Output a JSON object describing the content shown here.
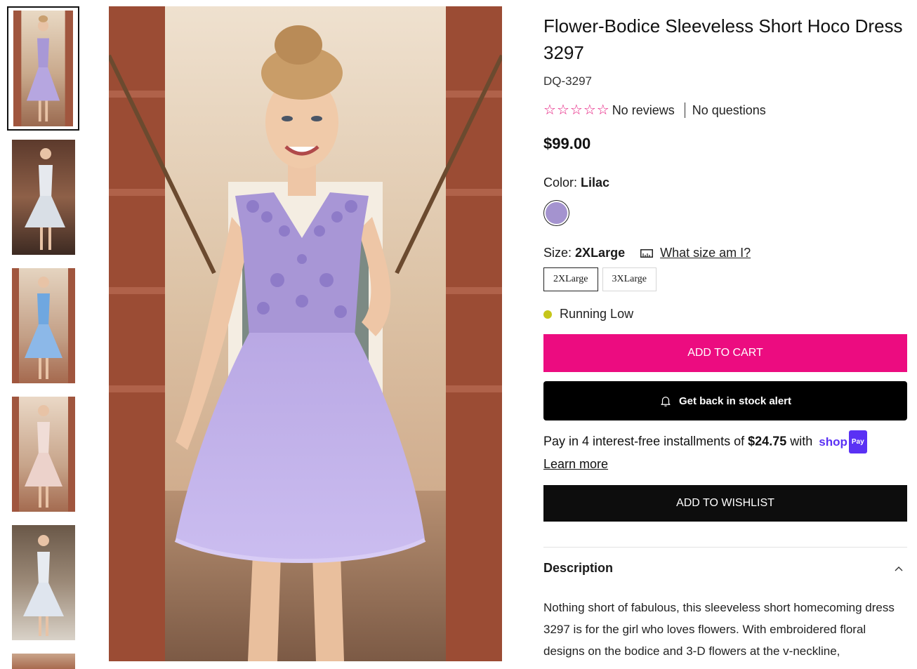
{
  "product": {
    "title": "Flower-Bodice Sleeveless Short Hoco Dress 3297",
    "sku": "DQ-3297",
    "reviews": "No reviews",
    "questions": "No questions",
    "rating": 0,
    "price": "$99.00"
  },
  "color": {
    "label": "Color:",
    "value": "Lilac",
    "swatch_hex": "#a493cf"
  },
  "size": {
    "label": "Size:",
    "value": "2XLarge",
    "guide_link": "What size am I?",
    "options": [
      "2XLarge",
      "3XLarge"
    ]
  },
  "stock": {
    "text": "Running Low",
    "dot_color": "#c6c61a"
  },
  "buttons": {
    "add_to_cart": "ADD TO CART",
    "stock_alert": "Get back in stock alert",
    "wishlist": "ADD TO WISHLIST"
  },
  "shoppay": {
    "prefix": "Pay in 4 interest-free installments of",
    "amount": "$24.75",
    "suffix": "with",
    "logo_text": "shop",
    "logo_badge": "Pay",
    "learn_more": "Learn more"
  },
  "description": {
    "heading": "Description",
    "text": "Nothing short of fabulous, this sleeveless short homecoming dress 3297 is for the girl who loves flowers. With embroidered floral designs on the bodice and 3-D flowers at the v-neckline,"
  },
  "thumbnails": [
    {
      "dress_color": "#b6a6e0",
      "active": true
    },
    {
      "dress_color": "#d9dfe6"
    },
    {
      "dress_color": "#8cb8e8"
    },
    {
      "dress_color": "#ecd2cb"
    },
    {
      "dress_color": "#dfe5ee"
    },
    {
      "dress_color": "#c9a48a"
    }
  ],
  "colors": {
    "accent_pink": "#ec0c80",
    "star_pink": "#e6197e",
    "shop_purple": "#5a31f4"
  }
}
